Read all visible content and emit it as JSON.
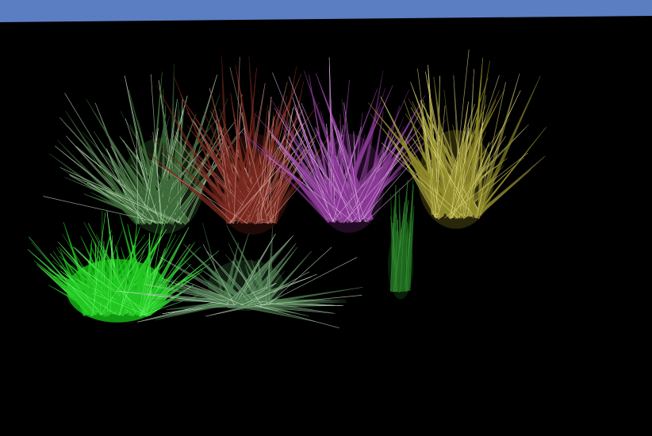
{
  "scene": {
    "sky_color": "#5b7dc2",
    "ground_color": "#000000",
    "grass_clumps": [
      {
        "name": "grass-clump-dark-green",
        "blade_color": "#3d6b3a",
        "highlight_color": "#c9e6c4",
        "core_color": "#1f3d1c",
        "blade_count": 70
      },
      {
        "name": "grass-clump-dark-red",
        "blade_color": "#7a2a20",
        "highlight_color": "#d9a49a",
        "core_color": "#3a120d",
        "blade_count": 70
      },
      {
        "name": "grass-clump-purple",
        "blade_color": "#8a3a96",
        "highlight_color": "#e9b8ef",
        "core_color": "#3d1642",
        "blade_count": 70
      },
      {
        "name": "grass-clump-yellow",
        "blade_color": "#8f8a2a",
        "highlight_color": "#e8e08a",
        "core_color": "#4a4612",
        "blade_count": 70
      },
      {
        "name": "grass-clump-bright-green",
        "blade_color": "#22c722",
        "highlight_color": "#6dff6d",
        "core_color": "#12a012",
        "blade_count": 90
      },
      {
        "name": "grass-clump-pale-green",
        "blade_color": "#4f7f52",
        "highlight_color": "#cfe9cf",
        "core_color": "#233d25",
        "blade_count": 60
      },
      {
        "name": "grass-clump-small-green",
        "blade_color": "#1f6a1f",
        "highlight_color": "#3f9a3f",
        "core_color": "#0f3a0f",
        "blade_count": 28
      }
    ]
  }
}
